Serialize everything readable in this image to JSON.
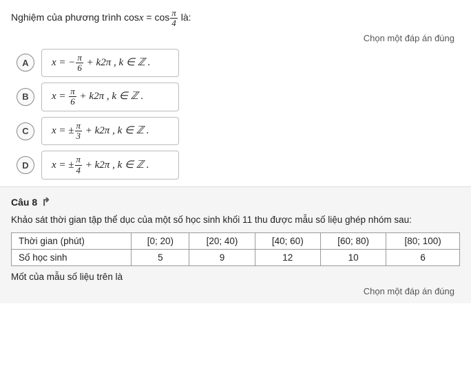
{
  "q7": {
    "header": "Nghiệm của phương trình cosx = cos",
    "header_fraction_num": "π",
    "header_fraction_den": "4",
    "header_suffix": " là:",
    "hint": "Chọn một đáp án đúng",
    "options": [
      {
        "label": "A",
        "formula_prefix": "x = −",
        "fraction_num": "π",
        "fraction_den": "6",
        "formula_suffix": "+ k2π , k ∈ ℤ ."
      },
      {
        "label": "B",
        "formula_prefix": "x =",
        "fraction_num": "π",
        "fraction_den": "6",
        "formula_suffix": "+ k2π , k ∈ ℤ ."
      },
      {
        "label": "C",
        "formula_prefix": "x = ±",
        "fraction_num": "π",
        "fraction_den": "3",
        "formula_suffix": "+ k2π , k ∈ ℤ ."
      },
      {
        "label": "D",
        "formula_prefix": "x = ±",
        "fraction_num": "π",
        "fraction_den": "4",
        "formula_suffix": "+ k2π , k ∈ ℤ ."
      }
    ]
  },
  "q8": {
    "number": "Câu 8",
    "description": "Khảo sát thời gian tập thể dục của một số học sinh khối 11 thu được mẫu số liệu ghép nhóm sau:",
    "table": {
      "col_headers": [
        "Thời gian (phút)",
        "[0; 20)",
        "[20; 40)",
        "[40; 60)",
        "[60; 80)",
        "[80; 100)"
      ],
      "row_label": "Số học sinh",
      "row_values": [
        "5",
        "9",
        "12",
        "10",
        "6"
      ]
    },
    "footer": "Mốt của mẫu số liệu trên là",
    "hint": "Chọn một đáp án đúng"
  }
}
